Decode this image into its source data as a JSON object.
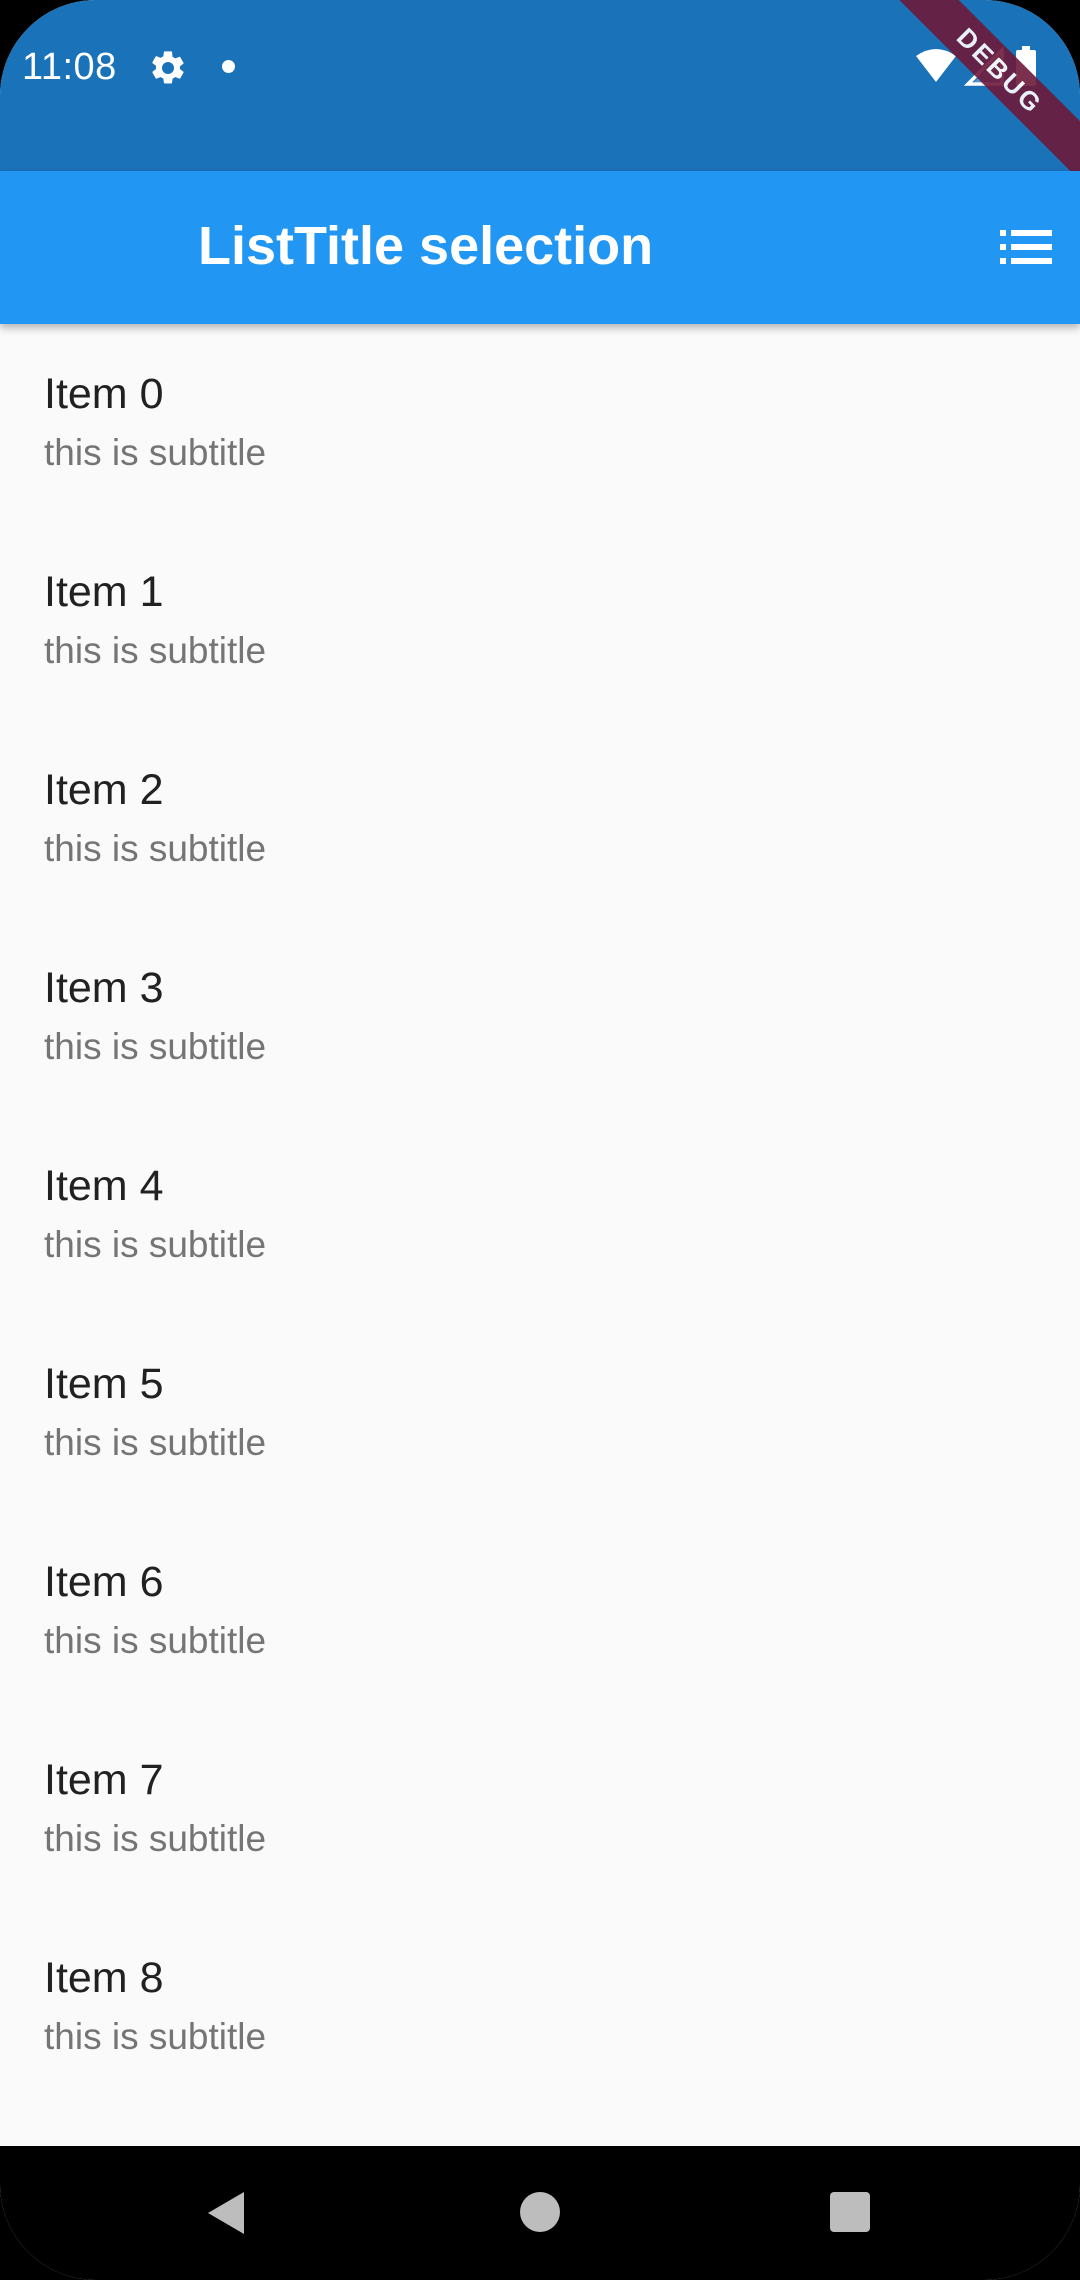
{
  "status_bar": {
    "time": "11:08",
    "icons": [
      "settings-icon",
      "notification-dot-icon",
      "wifi-icon",
      "cell-signal-icon",
      "battery-icon"
    ],
    "color": "#1a72b9"
  },
  "debug_banner": {
    "label": "DEBUG",
    "color": "#6d1a3a"
  },
  "app_bar": {
    "title": "ListTitle selection",
    "action_icon": "list-icon",
    "color": "#2196f3"
  },
  "list": {
    "items": [
      {
        "title": "Item 0",
        "subtitle": "this is subtitle"
      },
      {
        "title": "Item 1",
        "subtitle": "this is subtitle"
      },
      {
        "title": "Item 2",
        "subtitle": "this is subtitle"
      },
      {
        "title": "Item 3",
        "subtitle": "this is subtitle"
      },
      {
        "title": "Item 4",
        "subtitle": "this is subtitle"
      },
      {
        "title": "Item 5",
        "subtitle": "this is subtitle"
      },
      {
        "title": "Item 6",
        "subtitle": "this is subtitle"
      },
      {
        "title": "Item 7",
        "subtitle": "this is subtitle"
      },
      {
        "title": "Item 8",
        "subtitle": "this is subtitle"
      }
    ]
  },
  "nav_bar": {
    "icons": [
      "back-icon",
      "home-icon",
      "recents-icon"
    ]
  }
}
